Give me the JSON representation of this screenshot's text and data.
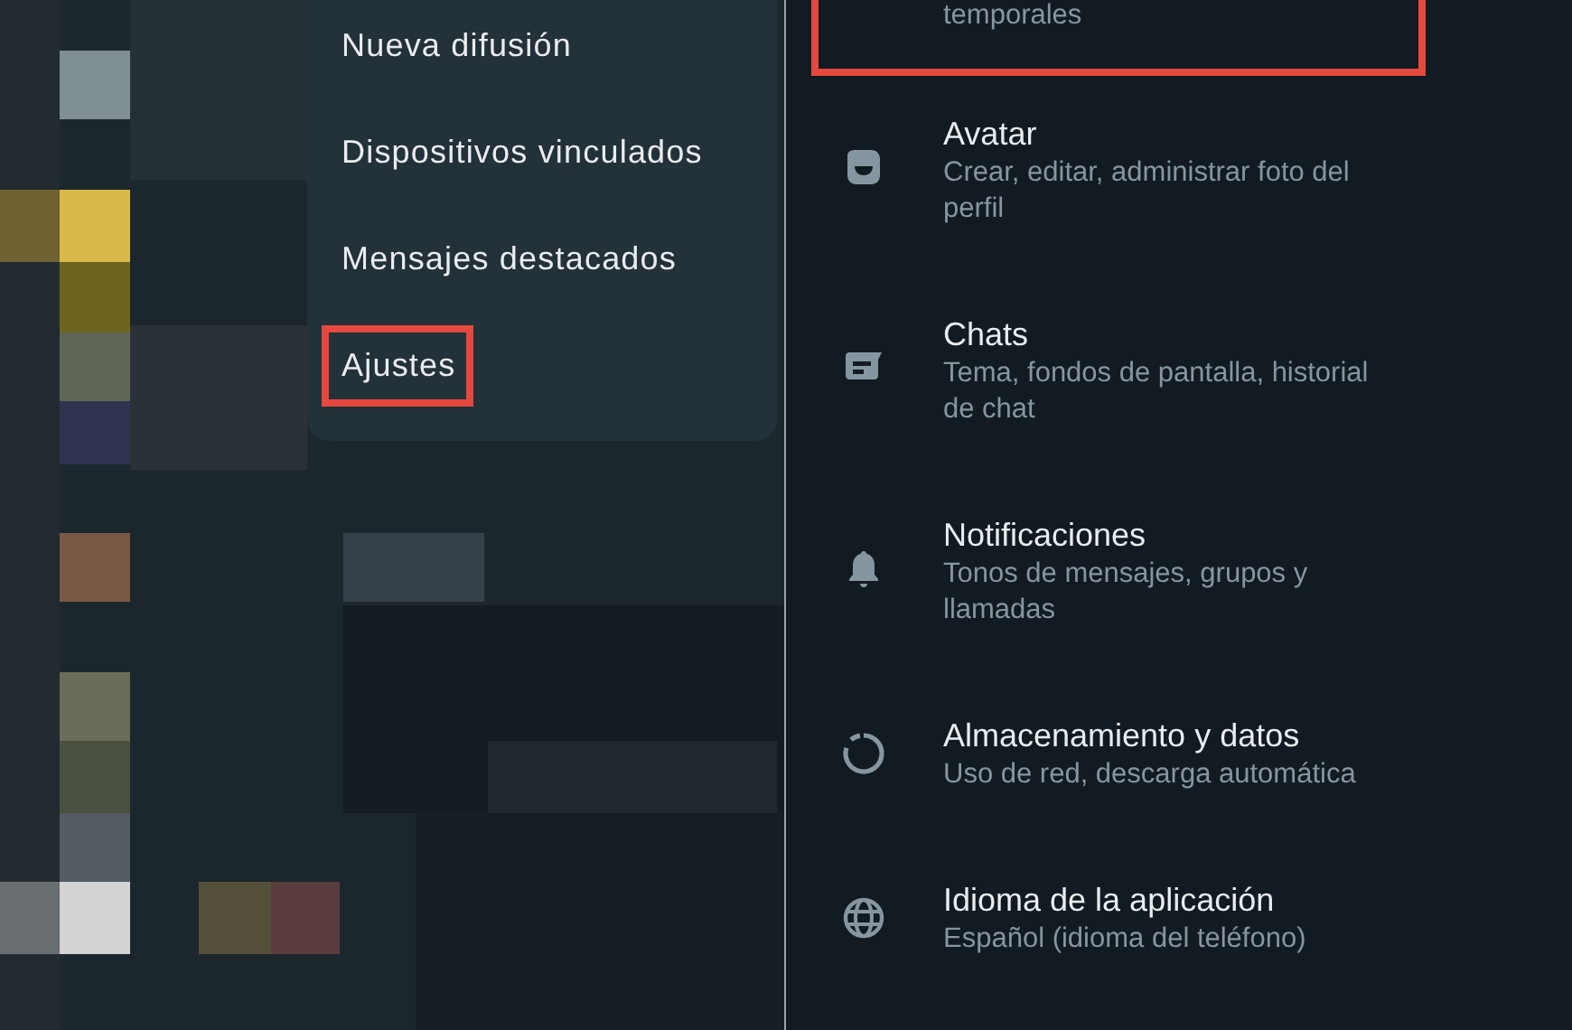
{
  "menu": {
    "items": [
      {
        "label": "Nueva difusión",
        "highlighted": false
      },
      {
        "label": "Dispositivos vinculados",
        "highlighted": false
      },
      {
        "label": "Mensajes destacados",
        "highlighted": false
      },
      {
        "label": "Ajustes",
        "highlighted": true
      }
    ]
  },
  "settings": {
    "items": [
      {
        "kind": "cut",
        "subtitle_lines": [
          "temporales"
        ],
        "highlighted": true
      },
      {
        "kind": "avatar",
        "title": "Avatar",
        "subtitle_lines": [
          "Crear, editar, administrar foto del",
          "perfil"
        ],
        "highlighted": false
      },
      {
        "kind": "chats",
        "title": "Chats",
        "subtitle_lines": [
          "Tema, fondos de pantalla, historial",
          "de chat"
        ],
        "highlighted": false
      },
      {
        "kind": "notifications",
        "title": "Notificaciones",
        "subtitle_lines": [
          "Tonos de mensajes, grupos y",
          "llamadas"
        ],
        "highlighted": false
      },
      {
        "kind": "storage",
        "title": "Almacenamiento y datos",
        "subtitle_lines": [
          "Uso de red, descarga automática"
        ],
        "highlighted": false
      },
      {
        "kind": "language",
        "title": "Idioma de la aplicación",
        "subtitle_lines": [
          "Español (idioma del teléfono)"
        ],
        "highlighted": false
      }
    ]
  }
}
